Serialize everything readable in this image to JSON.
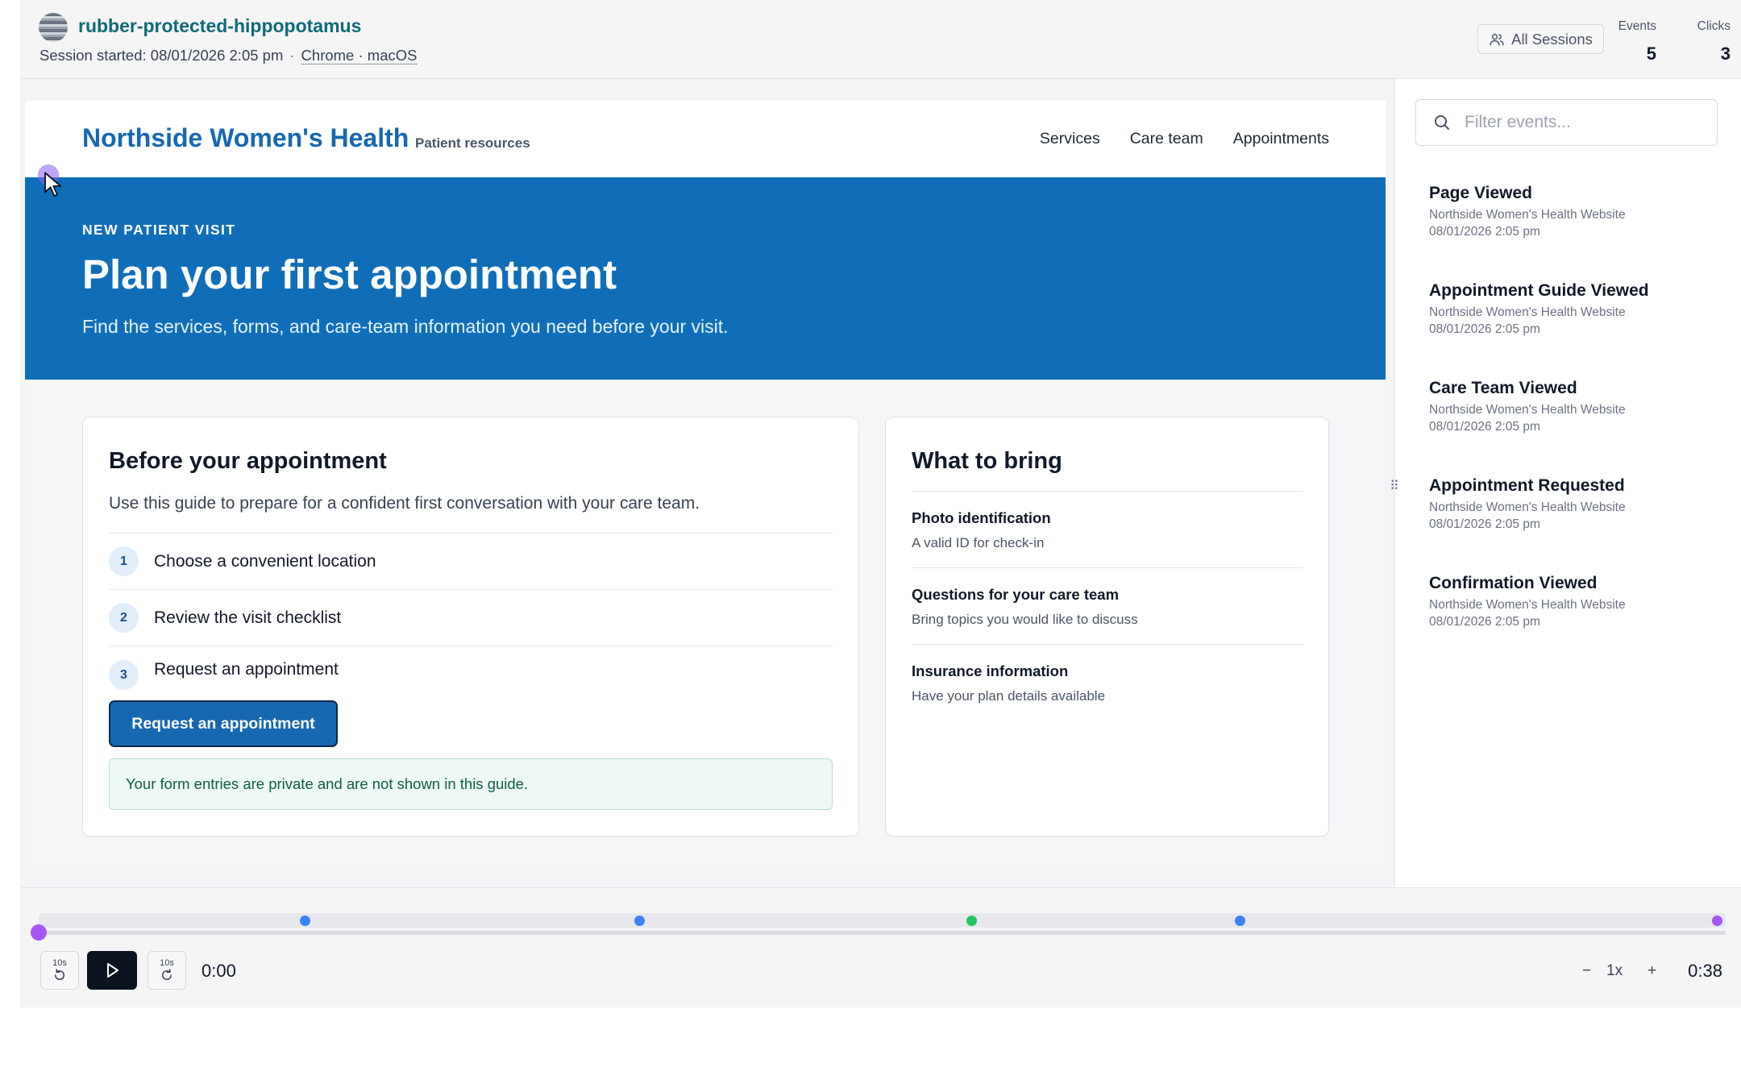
{
  "session": {
    "name": "rubber-protected-hippopotamus",
    "started": "Session started: 08/01/2026 2:05 pm",
    "separator": "·",
    "browser": "Chrome · macOS",
    "all_sessions_label": "All Sessions",
    "stats": {
      "events_label": "Events",
      "events_value": "5",
      "clicks_label": "Clicks",
      "clicks_value": "3"
    }
  },
  "site": {
    "brand": "Northside Women's Health",
    "brand_sub": "Patient resources",
    "nav": [
      "Services",
      "Care team",
      "Appointments"
    ],
    "hero": {
      "eyebrow": "NEW PATIENT VISIT",
      "title": "Plan your first appointment",
      "subtitle": "Find the services, forms, and care-team information you need before your visit."
    },
    "before": {
      "title": "Before your appointment",
      "intro": "Use this guide to prepare for a confident first conversation with your care team.",
      "steps": [
        {
          "num": "1",
          "text": "Choose a convenient location"
        },
        {
          "num": "2",
          "text": "Review the visit checklist"
        },
        {
          "num": "3",
          "text": "Request an appointment"
        }
      ],
      "cta": "Request an appointment",
      "privacy": "Your form entries are private and are not shown in this guide."
    },
    "bring": {
      "title": "What to bring",
      "items": [
        {
          "title": "Photo identification",
          "desc": "A valid ID for check-in"
        },
        {
          "title": "Questions for your care team",
          "desc": "Bring topics you would like to discuss"
        },
        {
          "title": "Insurance information",
          "desc": "Have your plan details available"
        }
      ]
    }
  },
  "sidebar": {
    "search_placeholder": "Filter events...",
    "events": [
      {
        "name": "Page Viewed",
        "source": "Northside Women's Health Website",
        "time": "08/01/2026 2:05 pm"
      },
      {
        "name": "Appointment Guide Viewed",
        "source": "Northside Women's Health Website",
        "time": "08/01/2026 2:05 pm"
      },
      {
        "name": "Care Team Viewed",
        "source": "Northside Women's Health Website",
        "time": "08/01/2026 2:05 pm"
      },
      {
        "name": "Appointment Requested",
        "source": "Northside Women's Health Website",
        "time": "08/01/2026 2:05 pm"
      },
      {
        "name": "Confirmation Viewed",
        "source": "Northside Women's Health Website",
        "time": "08/01/2026 2:05 pm"
      }
    ]
  },
  "player": {
    "skip_back_label": "10s",
    "skip_forward_label": "10s",
    "current_time": "0:00",
    "end_time": "0:38",
    "speed_minus": "−",
    "speed": "1x",
    "speed_plus": "+",
    "progress_fraction": 0,
    "markers": [
      {
        "fraction": 0.158,
        "color": "#3b82f6"
      },
      {
        "fraction": 0.356,
        "color": "#3b82f6"
      },
      {
        "fraction": 0.553,
        "color": "#22c55e"
      },
      {
        "fraction": 0.712,
        "color": "#3b82f6"
      },
      {
        "fraction": 1.0,
        "color": "#a855f7"
      }
    ]
  },
  "colors": {
    "brand_blue": "#1668b0",
    "session_teal": "#0e6b78",
    "playhead_purple": "#a855f7"
  },
  "icons": [
    "user-group-icon",
    "search-icon",
    "cursor-icon",
    "replay-back-icon",
    "play-icon",
    "replay-forward-icon",
    "drag-handle-icon"
  ]
}
